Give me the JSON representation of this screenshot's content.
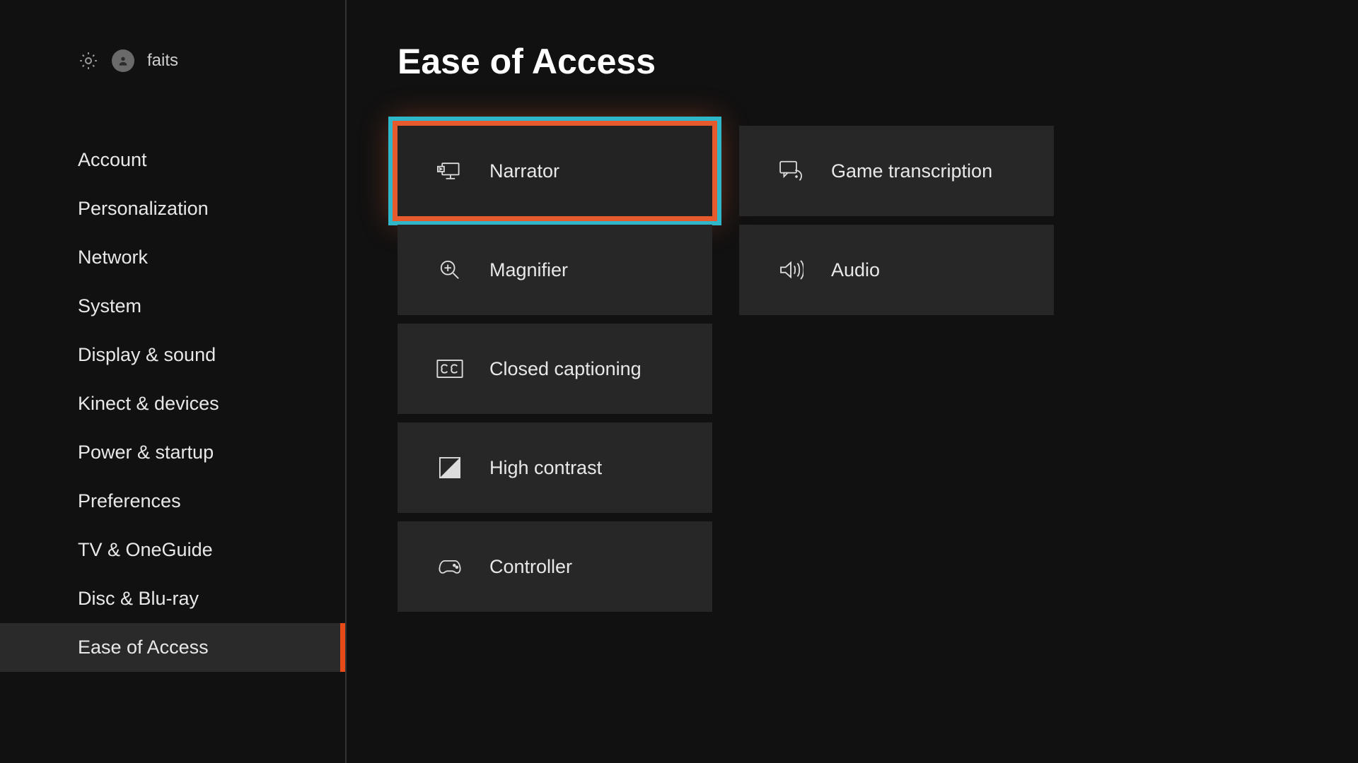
{
  "header": {
    "username": "faits"
  },
  "sidebar": {
    "items": [
      {
        "label": "Account"
      },
      {
        "label": "Personalization"
      },
      {
        "label": "Network"
      },
      {
        "label": "System"
      },
      {
        "label": "Display & sound"
      },
      {
        "label": "Kinect & devices"
      },
      {
        "label": "Power & startup"
      },
      {
        "label": "Preferences"
      },
      {
        "label": "TV & OneGuide"
      },
      {
        "label": "Disc & Blu-ray"
      },
      {
        "label": "Ease of Access"
      }
    ],
    "active_index": 10
  },
  "main": {
    "title": "Ease of Access",
    "columns": [
      [
        {
          "label": "Narrator",
          "icon": "narrator-icon",
          "selected": true
        },
        {
          "label": "Magnifier",
          "icon": "magnifier-icon"
        },
        {
          "label": "Closed captioning",
          "icon": "closed-caption-icon"
        },
        {
          "label": "High contrast",
          "icon": "high-contrast-icon"
        },
        {
          "label": "Controller",
          "icon": "controller-icon"
        }
      ],
      [
        {
          "label": "Game transcription",
          "icon": "transcription-icon"
        },
        {
          "label": "Audio",
          "icon": "audio-icon"
        }
      ]
    ]
  },
  "colors": {
    "accent": "#e65a2d",
    "focus_ring": "#2fb7c9",
    "background": "#111111",
    "tile": "#272727"
  }
}
